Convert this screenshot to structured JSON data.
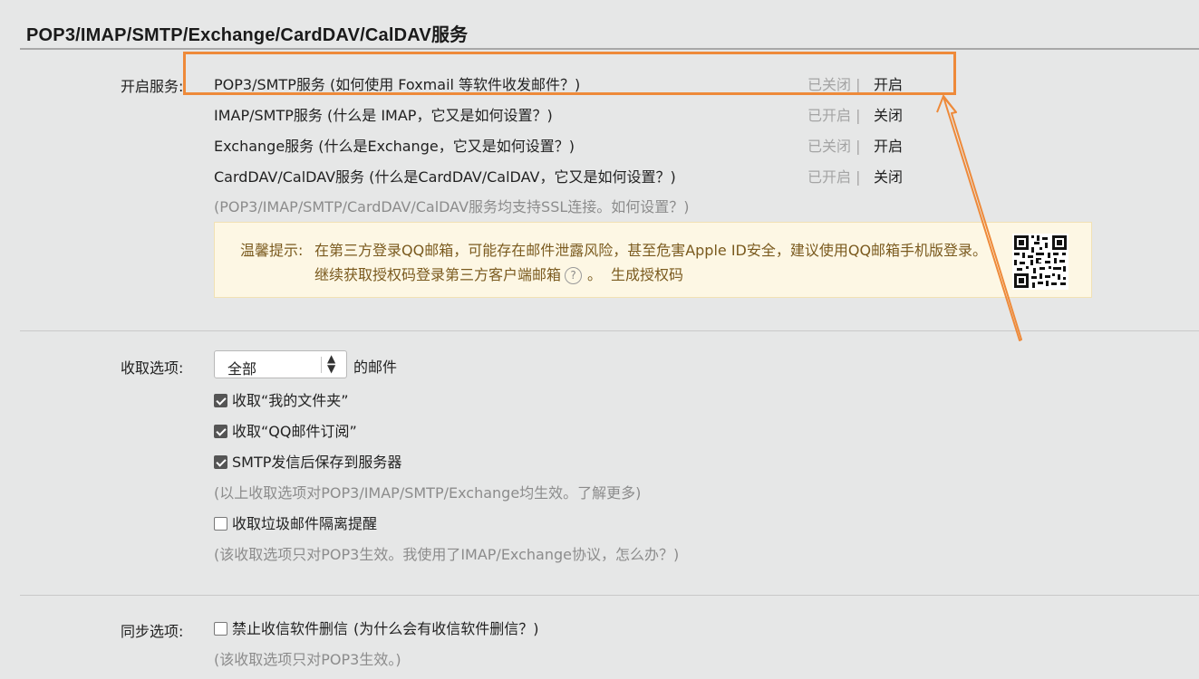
{
  "page": {
    "title": "POP3/IMAP/SMTP/Exchange/CardDAV/CalDAV服务"
  },
  "services": {
    "label": "开启服务:",
    "rows": [
      {
        "name": "POP3/SMTP服务",
        "help": " (如何使用 Foxmail 等软件收发邮件？)",
        "status": "已关闭 |",
        "action": "开启"
      },
      {
        "name": "IMAP/SMTP服务",
        "help": " (什么是 IMAP，它又是如何设置？)",
        "status": "已开启 |",
        "action": "关闭"
      },
      {
        "name": "Exchange服务",
        "help": " (什么是Exchange，它又是如何设置？)",
        "status": "已关闭 |",
        "action": "开启"
      },
      {
        "name": "CardDAV/CalDAV服务",
        "help": " (什么是CardDAV/CalDAV，它又是如何设置？)",
        "status": "已开启 |",
        "action": "关闭"
      }
    ],
    "ssl_note": "(POP3/IMAP/SMTP/CardDAV/CalDAV服务均支持SSL连接。如何设置？)"
  },
  "notice": {
    "label": "温馨提示:",
    "line1": "在第三方登录QQ邮箱，可能存在邮件泄露风险，甚至危害Apple ID安全，建议使用QQ邮箱手机版登录。",
    "line2": "继续获取授权码登录第三方客户端邮箱",
    "help_glyph": "?",
    "line2_tail": "。",
    "generate_link": "生成授权码",
    "qr_icon": "qr-code"
  },
  "receive": {
    "label": "收取选项:",
    "select_value": "全部",
    "select_suffix": "的邮件",
    "checkbox_my_folders": {
      "label": "收取“我的文件夹”",
      "checked": true
    },
    "checkbox_qq_subscriptions": {
      "label": "收取“QQ邮件订阅”",
      "checked": true
    },
    "checkbox_smtp_save": {
      "label": "SMTP发信后保存到服务器",
      "checked": true
    },
    "note1": "(以上收取选项对POP3/IMAP/SMTP/Exchange均生效。了解更多)",
    "checkbox_spam": {
      "label": "收取垃圾邮件隔离提醒",
      "checked": false
    },
    "note2": "(该收取选项只对POP3生效。我使用了IMAP/Exchange协议，怎么办？)"
  },
  "sync": {
    "label": "同步选项:",
    "checkbox_no_delete": {
      "label": "禁止收信软件删信",
      "checked": false
    },
    "checkbox_no_delete_help": "(为什么会有收信软件删信？)",
    "note": "(该收取选项只对POP3生效。)"
  },
  "colors": {
    "annotation": "#ee8a3a",
    "notice_bg": "#fdf7e4",
    "notice_text": "#7a5a1e"
  }
}
